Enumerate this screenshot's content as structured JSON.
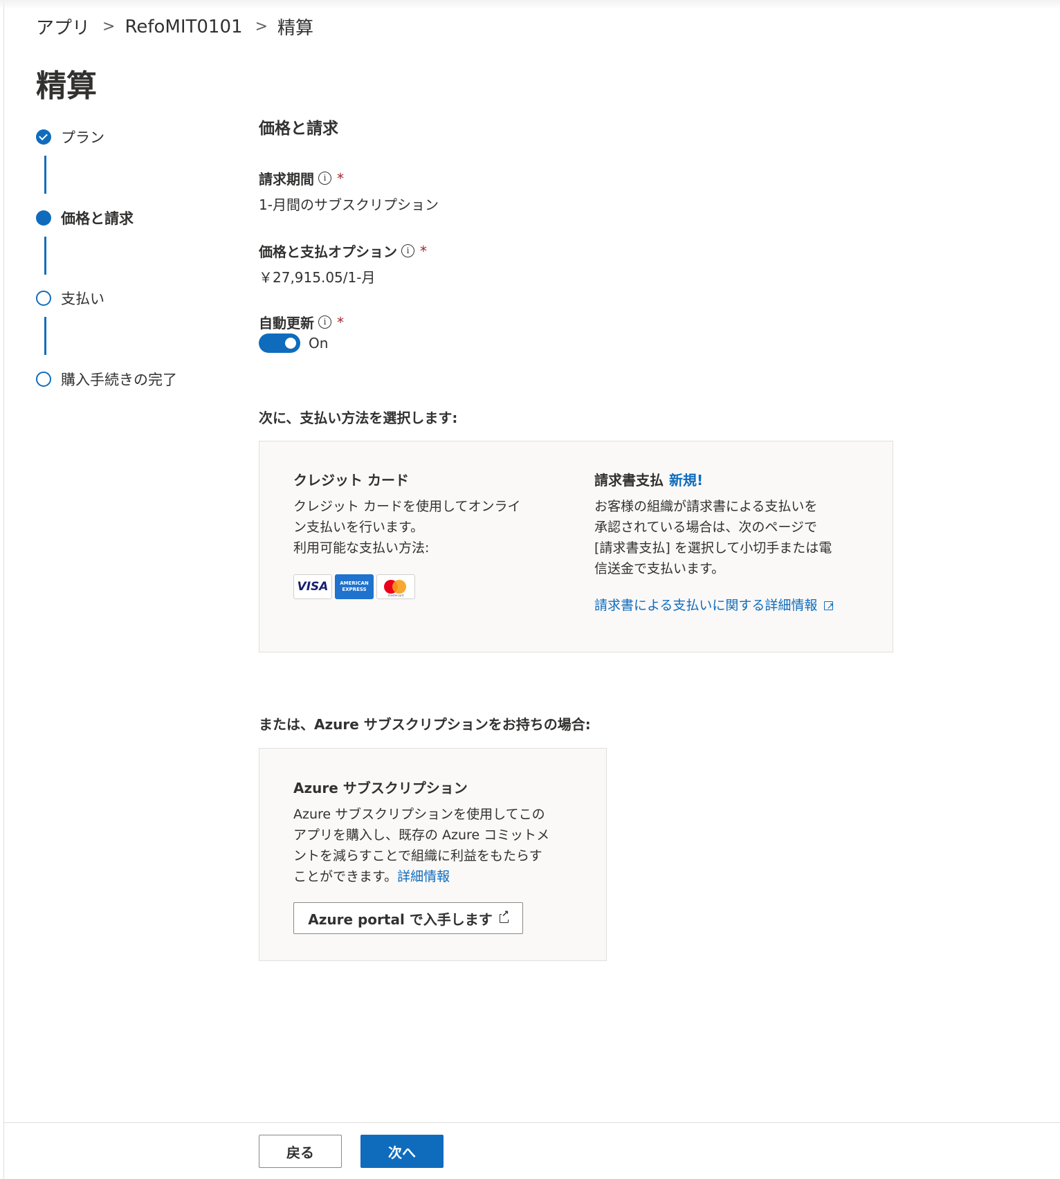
{
  "breadcrumb": {
    "items": [
      "アプリ",
      "RefoMIT0101",
      "精算"
    ],
    "separator": ">"
  },
  "page_title": "精算",
  "stepper": {
    "steps": [
      {
        "label": "プラン",
        "state": "done"
      },
      {
        "label": "価格と請求",
        "state": "current"
      },
      {
        "label": "支払い",
        "state": "todo"
      },
      {
        "label": "購入手続きの完了",
        "state": "todo"
      }
    ]
  },
  "section_title": "価格と請求",
  "billing_period": {
    "label": "請求期間",
    "info_icon": "i",
    "required": "*",
    "value": "1-月間のサブスクリプション"
  },
  "price_option": {
    "label": "価格と支払オプション",
    "info_icon": "i",
    "required": "*",
    "value": "￥27,915.05/1-月"
  },
  "auto_renew": {
    "label": "自動更新",
    "info_icon": "i",
    "required": "*",
    "toggle_state": "On",
    "toggle_on": true
  },
  "payment_prompt": "次に、支払い方法を選択します:",
  "credit_card": {
    "title": "クレジット カード",
    "text_lines": [
      "クレジット カードを使用してオンライ",
      "ン支払いを行います。",
      "利用可能な支払い方法:"
    ],
    "logos": [
      {
        "name": "visa-logo",
        "text": "VISA"
      },
      {
        "name": "amex-logo",
        "text": "AMERICAN EXPRESS"
      },
      {
        "name": "mastercard-logo",
        "text": "mastercard"
      }
    ]
  },
  "invoice": {
    "title": "請求書支払",
    "badge": "新規!",
    "text_lines": [
      "お客様の組織が請求書による支払いを",
      "承認されている場合は、次のページで",
      "[請求書支払] を選択して小切手または電",
      "信送金で支払います。"
    ],
    "link": "請求書による支払いに関する詳細情報"
  },
  "azure_prompt": "または、Azure サブスクリプションをお持ちの場合:",
  "azure": {
    "title": "Azure サブスクリプション",
    "text_lines": [
      "Azure サブスクリプションを使用してこの",
      "アプリを購入し、既存の Azure コミットメ",
      "ントを減らすことで組織に利益をもたらす",
      "ことができます。"
    ],
    "link": "詳細情報",
    "button": "Azure portal で入手します"
  },
  "footer": {
    "back": "戻る",
    "next": "次へ"
  },
  "colors": {
    "accent": "#0f6cbd",
    "required": "#a4262c",
    "card_bg": "#faf9f8"
  }
}
